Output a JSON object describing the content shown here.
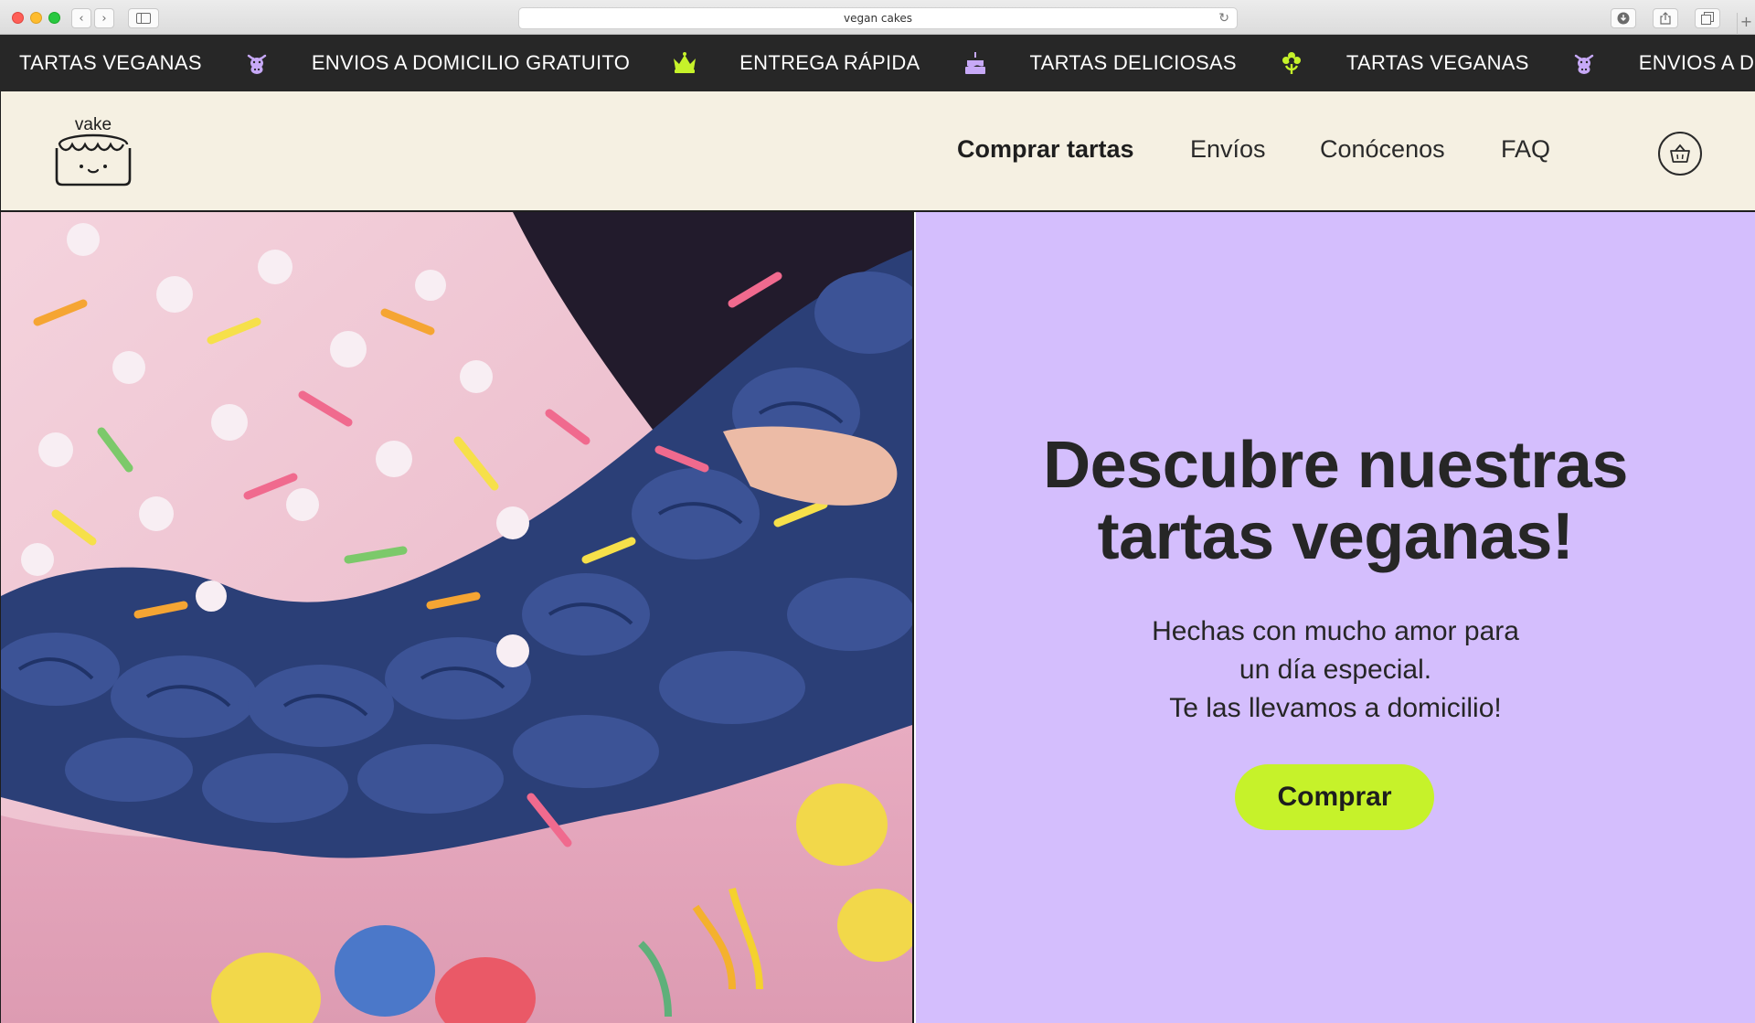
{
  "browser": {
    "url": "vegan cakes"
  },
  "marquee": {
    "items": [
      {
        "label": "TARTAS VEGANAS",
        "icon": "cow-icon",
        "icon_color": "#c7a9f7"
      },
      {
        "label": "ENVIOS A DOMICILIO GRATUITO",
        "icon": "crown-icon",
        "icon_color": "#c6f22a"
      },
      {
        "label": "ENTREGA RÁPIDA",
        "icon": "cake-icon",
        "icon_color": "#c7a9f7"
      },
      {
        "label": "TARTAS DELICIOSAS",
        "icon": "flower-icon",
        "icon_color": "#c6f22a"
      },
      {
        "label": "TARTAS VEGANAS",
        "icon": "cow-icon",
        "icon_color": "#c7a9f7"
      },
      {
        "label": "ENVIOS A DOMICILIO GRA",
        "icon": null,
        "icon_color": null
      }
    ]
  },
  "header": {
    "logo_text": "vake",
    "nav": [
      {
        "label": "Comprar tartas",
        "active": true
      },
      {
        "label": "Envíos",
        "active": false
      },
      {
        "label": "Conócenos",
        "active": false
      },
      {
        "label": "FAQ",
        "active": false
      }
    ],
    "cart_icon": "basket-icon"
  },
  "hero": {
    "title_line1": "Descubre nuestras",
    "title_line2": "tartas veganas!",
    "subtitle_line1": "Hechas con mucho amor para",
    "subtitle_line2": "un día especial.",
    "subtitle_line3": "Te las llevamos a domicilio!",
    "cta_label": "Comprar",
    "image_alt": "pink vegan cake with blue frosting and sprinkles"
  },
  "colors": {
    "marquee_bg": "#272727",
    "header_bg": "#f5f0e2",
    "hero_panel_bg": "#d4befd",
    "cta_bg": "#c6f22a",
    "text_dark": "#262626"
  }
}
